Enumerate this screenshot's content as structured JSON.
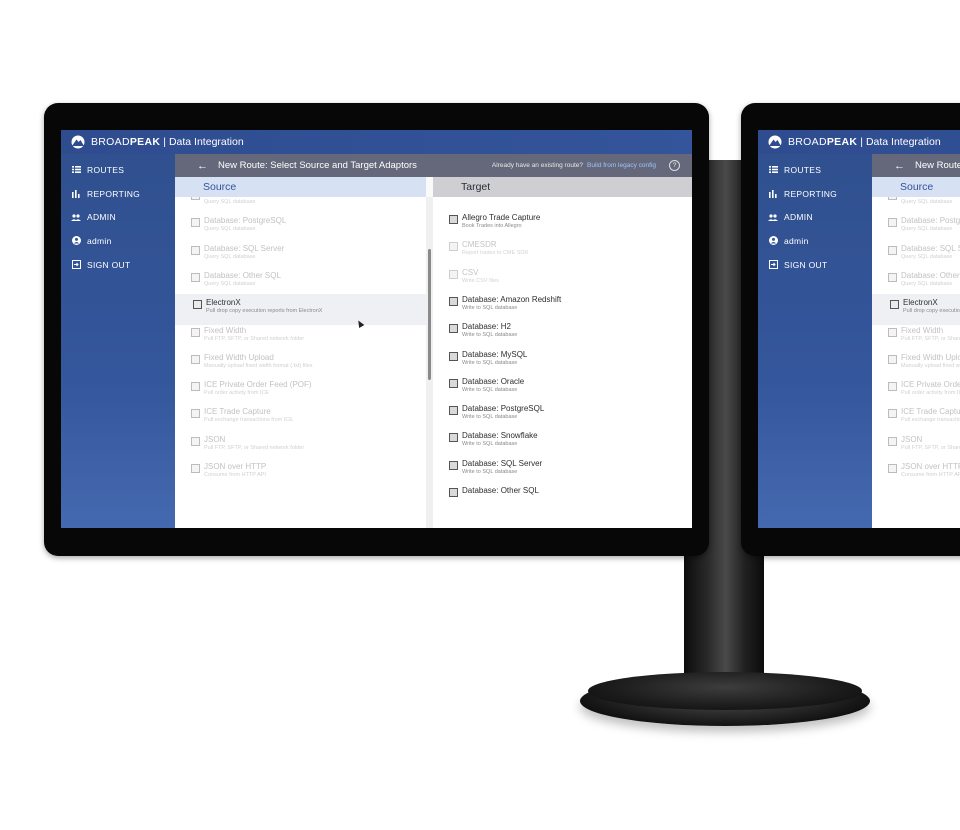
{
  "app": {
    "brand_light": "BROAD",
    "brand_bold": "PEAK",
    "brand_sep": "|",
    "brand_sub": "Data Integration"
  },
  "nav": [
    {
      "label": "ROUTES",
      "icon": "list-icon"
    },
    {
      "label": "REPORTING",
      "icon": "bar-chart-icon"
    },
    {
      "label": "ADMIN",
      "icon": "users-icon"
    },
    {
      "label": "admin",
      "icon": "user-circle-icon"
    },
    {
      "label": "SIGN OUT",
      "icon": "sign-out-icon"
    }
  ],
  "header": {
    "back_icon": "←",
    "title": "New Route: Select Source and Target Adaptors",
    "existing_prompt": "Already have an existing route?",
    "existing_link": "Build from legacy config",
    "help_icon": "?"
  },
  "source": {
    "heading": "Source",
    "items": [
      {
        "title": "Database: Oracle",
        "subtitle": "Query SQL database",
        "state": "disabled"
      },
      {
        "title": "Database: PostgreSQL",
        "subtitle": "Query SQL database",
        "state": "disabled"
      },
      {
        "title": "Database: SQL Server",
        "subtitle": "Query SQL database",
        "state": "disabled"
      },
      {
        "title": "Database: Other SQL",
        "subtitle": "Query SQL database",
        "state": "disabled"
      },
      {
        "title": "ElectronX",
        "subtitle": "Pull drop copy execution reports from ElectronX",
        "state": "hover"
      },
      {
        "title": "Fixed Width",
        "subtitle": "Pull FTP, SFTP, or Shared network folder",
        "state": "disabled"
      },
      {
        "title": "Fixed Width Upload",
        "subtitle": "Manually upload fixed width format (.txt) files",
        "state": "disabled"
      },
      {
        "title": "ICE Private Order Feed (POF)",
        "subtitle": "Pull order activity from ICE",
        "state": "disabled"
      },
      {
        "title": "ICE Trade Capture",
        "subtitle": "Pull exchange transactions from ICE",
        "state": "disabled"
      },
      {
        "title": "JSON",
        "subtitle": "Pull FTP, SFTP, or Shared network folder",
        "state": "disabled"
      },
      {
        "title": "JSON over HTTP",
        "subtitle": "Consume from HTTP API",
        "state": "disabled"
      }
    ]
  },
  "target": {
    "heading": "Target",
    "items": [
      {
        "title": "Allegro Trade Capture",
        "subtitle": "Book Trades into Allegro",
        "state": "enabled"
      },
      {
        "title": "CMESDR",
        "subtitle": "Report trades to CME SDR",
        "state": "disabled"
      },
      {
        "title": "CSV",
        "subtitle": "Write CSV files",
        "state": "disabled"
      },
      {
        "title": "Database: Amazon Redshift",
        "subtitle": "Write to SQL database",
        "state": "enabled"
      },
      {
        "title": "Database: H2",
        "subtitle": "Write to SQL database",
        "state": "enabled"
      },
      {
        "title": "Database: MySQL",
        "subtitle": "Write to SQL database",
        "state": "enabled"
      },
      {
        "title": "Database: Oracle",
        "subtitle": "Write to SQL database",
        "state": "enabled"
      },
      {
        "title": "Database: PostgreSQL",
        "subtitle": "Write to SQL database",
        "state": "enabled"
      },
      {
        "title": "Database: Snowflake",
        "subtitle": "Write to SQL database",
        "state": "enabled"
      },
      {
        "title": "Database: SQL Server",
        "subtitle": "Write to SQL database",
        "state": "enabled"
      },
      {
        "title": "Database: Other SQL",
        "subtitle": "",
        "state": "enabled"
      }
    ]
  },
  "colors": {
    "topbar": "#2f4c8f",
    "sidebar": "#34569b",
    "header": "#65687a",
    "source_head": "#d6e1f3",
    "target_head": "#cfcfd3",
    "link": "#9fc2ff"
  }
}
